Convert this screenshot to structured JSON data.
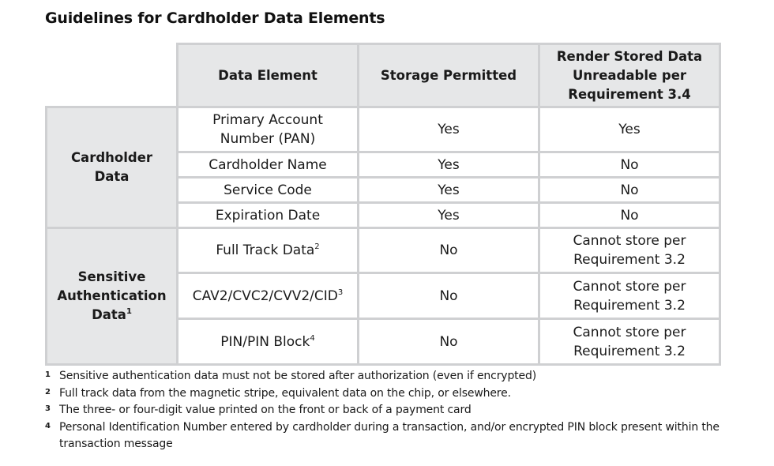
{
  "title": "Guidelines for Cardholder Data Elements",
  "table": {
    "headers": {
      "data_element": "Data Element",
      "storage_permitted": "Storage Permitted",
      "render_unreadable_line1": "Render Stored Data",
      "render_unreadable_line2": "Unreadable per",
      "render_unreadable_line3": "Requirement 3.4"
    },
    "groups": [
      {
        "label_line1": "Cardholder",
        "label_line2": "Data",
        "rows": [
          {
            "element_line1": "Primary Account",
            "element_line2": "Number (PAN)",
            "storage": "Yes",
            "render": "Yes"
          },
          {
            "element": "Cardholder Name",
            "storage": "Yes",
            "render": "No"
          },
          {
            "element": "Service Code",
            "storage": "Yes",
            "render": "No"
          },
          {
            "element": "Expiration Date",
            "storage": "Yes",
            "render": "No"
          }
        ]
      },
      {
        "label_line1": "Sensitive",
        "label_line2": "Authentication",
        "label_line3": "Data",
        "label_sup": "1",
        "rows": [
          {
            "element": "Full Track Data",
            "sup": "2",
            "storage": "No",
            "render_line1": "Cannot store per",
            "render_line2": "Requirement 3.2"
          },
          {
            "element": "CAV2/CVC2/CVV2/CID",
            "sup": "3",
            "storage": "No",
            "render_line1": "Cannot store per",
            "render_line2": "Requirement 3.2"
          },
          {
            "element": "PIN/PIN Block",
            "sup": "4",
            "storage": "No",
            "render_line1": "Cannot store per",
            "render_line2": "Requirement 3.2"
          }
        ]
      }
    ]
  },
  "footnotes": [
    {
      "mark": "1",
      "text": "Sensitive authentication data must not be stored after authorization (even if encrypted)"
    },
    {
      "mark": "2",
      "text": "Full track data from the magnetic stripe, equivalent data on the chip, or elsewhere."
    },
    {
      "mark": "3",
      "text": "The three- or four-digit value printed on the front or back of a payment card"
    },
    {
      "mark": "4",
      "text": "Personal Identification Number entered by cardholder during a transaction, and/or encrypted PIN block present within the transaction message"
    }
  ]
}
